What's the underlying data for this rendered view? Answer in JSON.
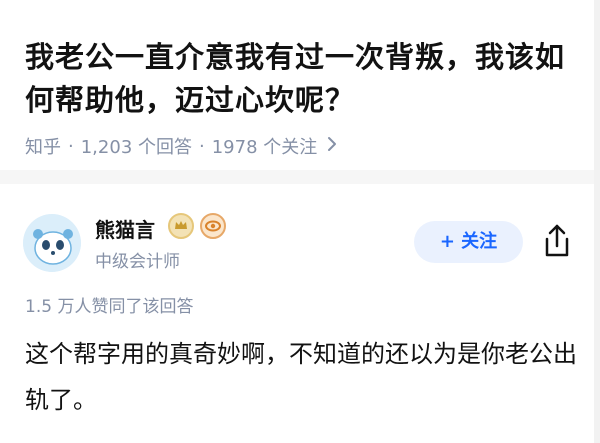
{
  "question": {
    "title": "我老公一直介意我有过一次背叛，我该如何帮助他，迈过心坎呢？",
    "source": "知乎",
    "answers_count": "1,203 个回答",
    "followers_count": "1978 个关注",
    "separator": "·"
  },
  "author": {
    "name": "熊猫言",
    "title": "中级会计师",
    "follow_label": "+ 关注",
    "badges": [
      "gold-badge-icon",
      "orange-eye-badge-icon"
    ]
  },
  "answer": {
    "vote_summary": "1.5 万人赞同了该回答",
    "content": "这个帮字用的真奇妙啊，不知道的还以为是你老公出轨了。"
  },
  "colors": {
    "title": "#121212",
    "meta": "#8590a6",
    "accent": "#1a66ff",
    "follow_bg": "#eaf1fe"
  }
}
